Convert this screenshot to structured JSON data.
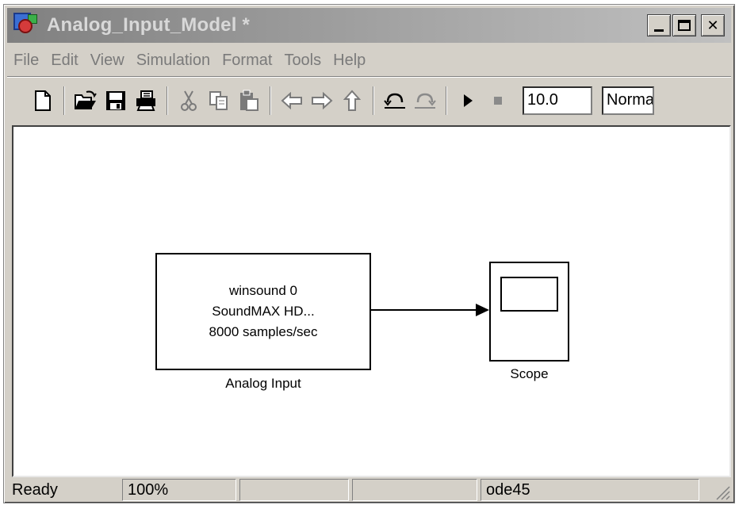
{
  "window": {
    "title": "Analog_Input_Model *"
  },
  "menu": [
    "File",
    "Edit",
    "View",
    "Simulation",
    "Format",
    "Tools",
    "Help"
  ],
  "toolbar": {
    "icons": [
      "new-model-icon",
      "open-folder-icon",
      "save-icon",
      "print-icon",
      "cut-icon",
      "copy-icon",
      "paste-icon",
      "back-arrow-icon",
      "forward-arrow-icon",
      "up-arrow-icon",
      "undo-icon",
      "redo-icon",
      "play-icon",
      "stop-icon"
    ],
    "stop_time": "10.0",
    "sim_mode": "Normal"
  },
  "diagram": {
    "analog_input": {
      "lines": [
        "winsound 0",
        "SoundMAX HD...",
        "8000 samples/sec"
      ],
      "label": "Analog Input"
    },
    "scope": {
      "label": "Scope"
    }
  },
  "status": {
    "state": "Ready",
    "zoom": "100%",
    "cell3": "",
    "cell4": "",
    "solver": "ode45"
  }
}
